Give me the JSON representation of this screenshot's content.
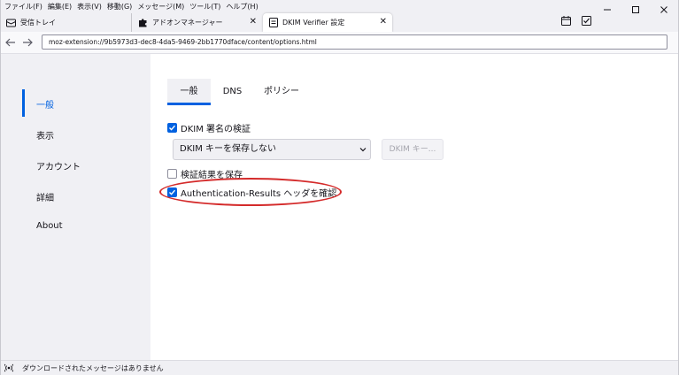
{
  "menubar": {
    "items": [
      "ファイル(F)",
      "編集(E)",
      "表示(V)",
      "移動(G)",
      "メッセージ(M)",
      "ツール(T)",
      "ヘルプ(H)"
    ]
  },
  "tabs": [
    {
      "label": "受信トレイ",
      "icon": "mail-icon"
    },
    {
      "label": "アドオンマネージャー",
      "icon": "puzzle-icon"
    },
    {
      "label": "DKIM Verifier 設定",
      "icon": "document-icon"
    }
  ],
  "nav": {
    "url": "moz-extension://9b5973d3-dec8-4da5-9469-2bb1770dface/content/options.html"
  },
  "sidebar": {
    "items": [
      {
        "label": "一般"
      },
      {
        "label": "表示"
      },
      {
        "label": "アカウント"
      },
      {
        "label": "詳細"
      },
      {
        "label": "About"
      }
    ]
  },
  "main": {
    "tabs": [
      {
        "label": "一般"
      },
      {
        "label": "DNS"
      },
      {
        "label": "ポリシー"
      }
    ],
    "verify_signature": {
      "label": "DKIM 署名の検証",
      "checked": true
    },
    "key_storage": {
      "selected": "DKIM キーを保存しない"
    },
    "dkim_keys_button": "DKIM キー...",
    "save_result": {
      "label": "検証結果を保存",
      "checked": false
    },
    "auth_results": {
      "label": "Authentication-Results ヘッダを確認",
      "checked": true
    }
  },
  "statusbar": {
    "text": "ダウンロードされたメッセージはありません"
  },
  "colors": {
    "accent": "#0061e0",
    "highlight": "#d42a2a"
  }
}
